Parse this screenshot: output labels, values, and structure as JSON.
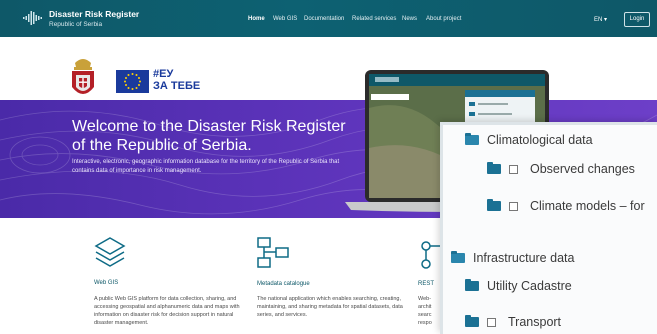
{
  "brand": {
    "title": "Disaster Risk Register",
    "subtitle": "Republic of Serbia"
  },
  "nav": {
    "items": [
      {
        "label": "Home",
        "active": true
      },
      {
        "label": "Web GIS",
        "active": false
      },
      {
        "label": "Documentation",
        "active": false
      },
      {
        "label": "Related services",
        "active": false
      },
      {
        "label": "News",
        "active": false
      },
      {
        "label": "About project",
        "active": false
      }
    ],
    "language": "EN ▾",
    "login": "Login"
  },
  "logos": {
    "eu_line1": "#ЕУ",
    "eu_line2": "ЗА ТЕБЕ"
  },
  "hero": {
    "title": "Welcome to the Disaster Risk Register of the Republic of Serbia.",
    "description": "Interactive, electronic, geographic information database for the territory of the Republic of Serbia that contains data of importance in risk management."
  },
  "features": [
    {
      "title": "Web GIS",
      "description": "A public Web GIS platform for data collection, sharing, and accessing geospatial and alphanumeric data and maps with information on disaster risk for decision support in natural disaster management."
    },
    {
      "title": "Metadata catalogue",
      "description": "The national application which enables searching, creating, maintaining, and sharing metadata for spatial datasets, data series, and services."
    },
    {
      "title": "REST",
      "description_lines": [
        "Web-",
        "archit",
        "searc",
        "respo"
      ]
    }
  ],
  "tree": {
    "items": [
      {
        "label": "Climatological data",
        "checkbox": false,
        "open": true
      },
      {
        "label": "Observed changes",
        "checkbox": true
      },
      {
        "label": "Climate models – for",
        "checkbox": true
      },
      {
        "label": "Infrastructure data",
        "checkbox": false,
        "open": true
      },
      {
        "label": "Utility Cadastre",
        "checkbox": false
      },
      {
        "label": "Transport",
        "checkbox": true
      }
    ]
  },
  "colors": {
    "navbar": "#0e5868",
    "hero": "#5a32b8",
    "folder": "#1b7194",
    "eu_blue": "#1a3a9c"
  }
}
